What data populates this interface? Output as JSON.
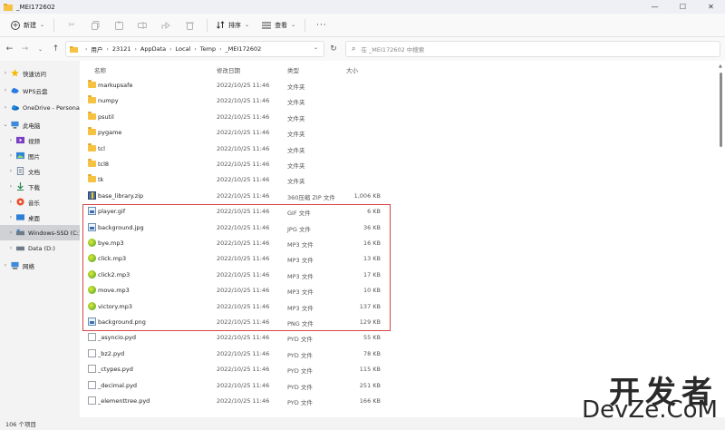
{
  "window": {
    "title": "_MEI172602",
    "minimize_glyph": "—",
    "maximize_glyph": "☐",
    "close_glyph": "✕"
  },
  "toolbar": {
    "new_label": "新建",
    "sort_label": "排序",
    "view_label": "查看",
    "more_label": "···"
  },
  "address": {
    "crumbs": [
      "用户",
      "23121",
      "AppData",
      "Local",
      "Temp",
      "_MEI172602"
    ],
    "search_placeholder": "在 _MEI172602 中搜索"
  },
  "sidebar": {
    "items": [
      {
        "label": "快速访问",
        "icon": "star-icon"
      },
      {
        "label": "WPS云盘",
        "icon": "cloud-icon"
      },
      {
        "label": "OneDrive - Persona",
        "icon": "onedrive-icon"
      },
      {
        "label": "此电脑",
        "icon": "computer-icon"
      },
      {
        "label": "视频",
        "icon": "video-icon"
      },
      {
        "label": "图片",
        "icon": "picture-icon"
      },
      {
        "label": "文档",
        "icon": "document-icon"
      },
      {
        "label": "下载",
        "icon": "download-icon"
      },
      {
        "label": "音乐",
        "icon": "music-icon"
      },
      {
        "label": "桌面",
        "icon": "desktop-icon"
      },
      {
        "label": "Windows-SSD (C:)",
        "icon": "drive-icon"
      },
      {
        "label": "Data (D:)",
        "icon": "drive-icon"
      },
      {
        "label": "网络",
        "icon": "network-icon"
      }
    ]
  },
  "columns": {
    "name": "名称",
    "date": "修改日期",
    "type": "类型",
    "size": "大小"
  },
  "files": [
    {
      "name": "markupsafe",
      "date": "2022/10/25 11:46",
      "type": "文件夹",
      "size": "",
      "kind": "folder"
    },
    {
      "name": "numpy",
      "date": "2022/10/25 11:46",
      "type": "文件夹",
      "size": "",
      "kind": "folder"
    },
    {
      "name": "psutil",
      "date": "2022/10/25 11:46",
      "type": "文件夹",
      "size": "",
      "kind": "folder"
    },
    {
      "name": "pygame",
      "date": "2022/10/25 11:46",
      "type": "文件夹",
      "size": "",
      "kind": "folder"
    },
    {
      "name": "tcl",
      "date": "2022/10/25 11:46",
      "type": "文件夹",
      "size": "",
      "kind": "folder"
    },
    {
      "name": "tcl8",
      "date": "2022/10/25 11:46",
      "type": "文件夹",
      "size": "",
      "kind": "folder"
    },
    {
      "name": "tk",
      "date": "2022/10/25 11:46",
      "type": "文件夹",
      "size": "",
      "kind": "folder"
    },
    {
      "name": "base_library.zip",
      "date": "2022/10/25 11:46",
      "type": "360压缩 ZIP 文件",
      "size": "1,006 KB",
      "kind": "zip"
    },
    {
      "name": "player.gif",
      "date": "2022/10/25 11:46",
      "type": "GIF 文件",
      "size": "6 KB",
      "kind": "img"
    },
    {
      "name": "background.jpg",
      "date": "2022/10/25 11:46",
      "type": "JPG 文件",
      "size": "36 KB",
      "kind": "img"
    },
    {
      "name": "bye.mp3",
      "date": "2022/10/25 11:46",
      "type": "MP3 文件",
      "size": "16 KB",
      "kind": "audio"
    },
    {
      "name": "click.mp3",
      "date": "2022/10/25 11:46",
      "type": "MP3 文件",
      "size": "13 KB",
      "kind": "audio"
    },
    {
      "name": "click2.mp3",
      "date": "2022/10/25 11:46",
      "type": "MP3 文件",
      "size": "17 KB",
      "kind": "audio"
    },
    {
      "name": "move.mp3",
      "date": "2022/10/25 11:46",
      "type": "MP3 文件",
      "size": "10 KB",
      "kind": "audio"
    },
    {
      "name": "victory.mp3",
      "date": "2022/10/25 11:46",
      "type": "MP3 文件",
      "size": "137 KB",
      "kind": "audio"
    },
    {
      "name": "background.png",
      "date": "2022/10/25 11:46",
      "type": "PNG 文件",
      "size": "129 KB",
      "kind": "img"
    },
    {
      "name": "_asyncio.pyd",
      "date": "2022/10/25 11:46",
      "type": "PYD 文件",
      "size": "55 KB",
      "kind": "file"
    },
    {
      "name": "_bz2.pyd",
      "date": "2022/10/25 11:46",
      "type": "PYD 文件",
      "size": "78 KB",
      "kind": "file"
    },
    {
      "name": "_ctypes.pyd",
      "date": "2022/10/25 11:46",
      "type": "PYD 文件",
      "size": "115 KB",
      "kind": "file"
    },
    {
      "name": "_decimal.pyd",
      "date": "2022/10/25 11:46",
      "type": "PYD 文件",
      "size": "251 KB",
      "kind": "file"
    },
    {
      "name": "_elementtree.pyd",
      "date": "2022/10/25 11:46",
      "type": "PYD 文件",
      "size": "166 KB",
      "kind": "file"
    }
  ],
  "status": {
    "count": "106 个项目"
  },
  "watermark": {
    "cn": "开发者",
    "en": "DevZe.CoM"
  },
  "colors": {
    "highlight_border": "#d64545",
    "selected_bg": "#cfd1d5",
    "folder": "#f5c242"
  }
}
